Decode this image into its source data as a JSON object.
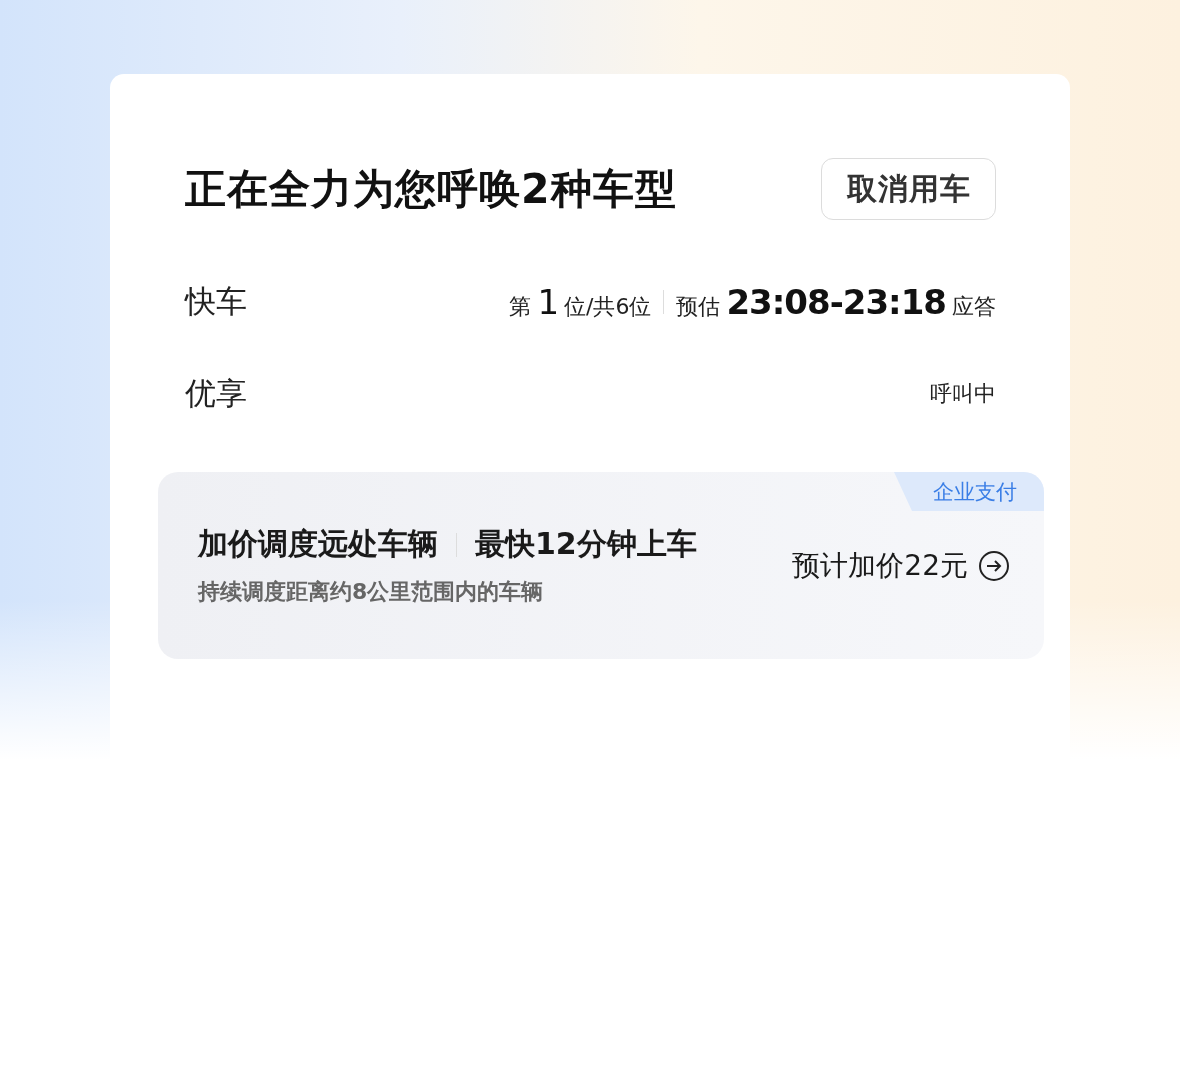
{
  "title": "正在全力为您呼唤2种车型",
  "cancel_button": "取消用车",
  "car_types": [
    {
      "kind": "queue",
      "name": "快车",
      "rank_prefix": "第",
      "rank": "1",
      "rank_suffix": "位/共6位",
      "eta_prefix": "预估",
      "eta": "23:08-23:18",
      "eta_suffix": "应答"
    },
    {
      "kind": "status",
      "name": "优享",
      "status": "呼叫中"
    }
  ],
  "dispatch_offer": {
    "badge": "企业支付",
    "headline": "加价调度远处车辆",
    "highlight": "最快12分钟上车",
    "description": "持续调度距离约8公里范围内的车辆",
    "price": "预计加价22元"
  }
}
